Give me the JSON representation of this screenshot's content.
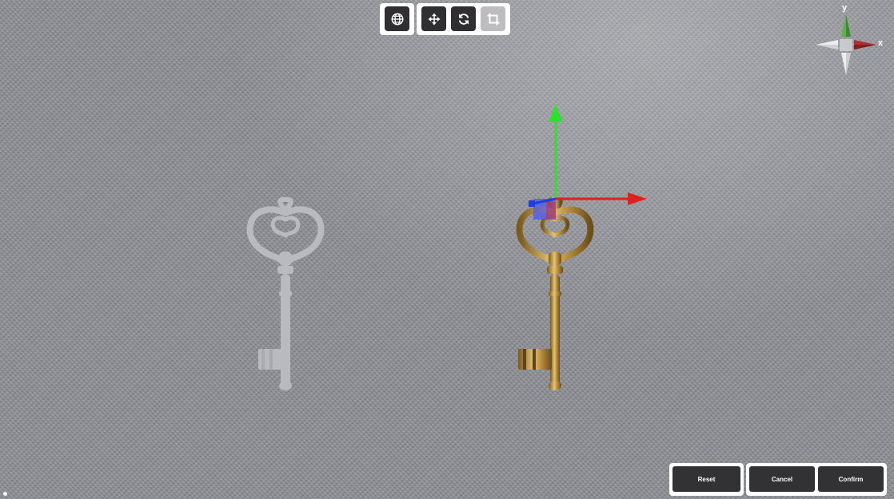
{
  "toolbar": {
    "left_group": [
      {
        "icon": "globe-icon",
        "active": true
      }
    ],
    "right_group": [
      {
        "icon": "move-icon",
        "active": true
      },
      {
        "icon": "rotate-icon",
        "active": true
      },
      {
        "icon": "crop-icon",
        "active": false
      }
    ]
  },
  "axis_gizmo": {
    "y_label": "y",
    "x_label": "x"
  },
  "actions": {
    "reset_label": "Reset",
    "cancel_label": "Cancel",
    "confirm_label": "Confirm"
  },
  "colors": {
    "background": "#8e9096",
    "axis_x": "#e0201e",
    "axis_y": "#2fe02f",
    "axis_z": "#1e3ee0",
    "key_gold": "#c9a44c",
    "key_ghost": "#b9babe",
    "button_dark": "#2f2f31",
    "button_inactive": "#bdbdbf"
  }
}
